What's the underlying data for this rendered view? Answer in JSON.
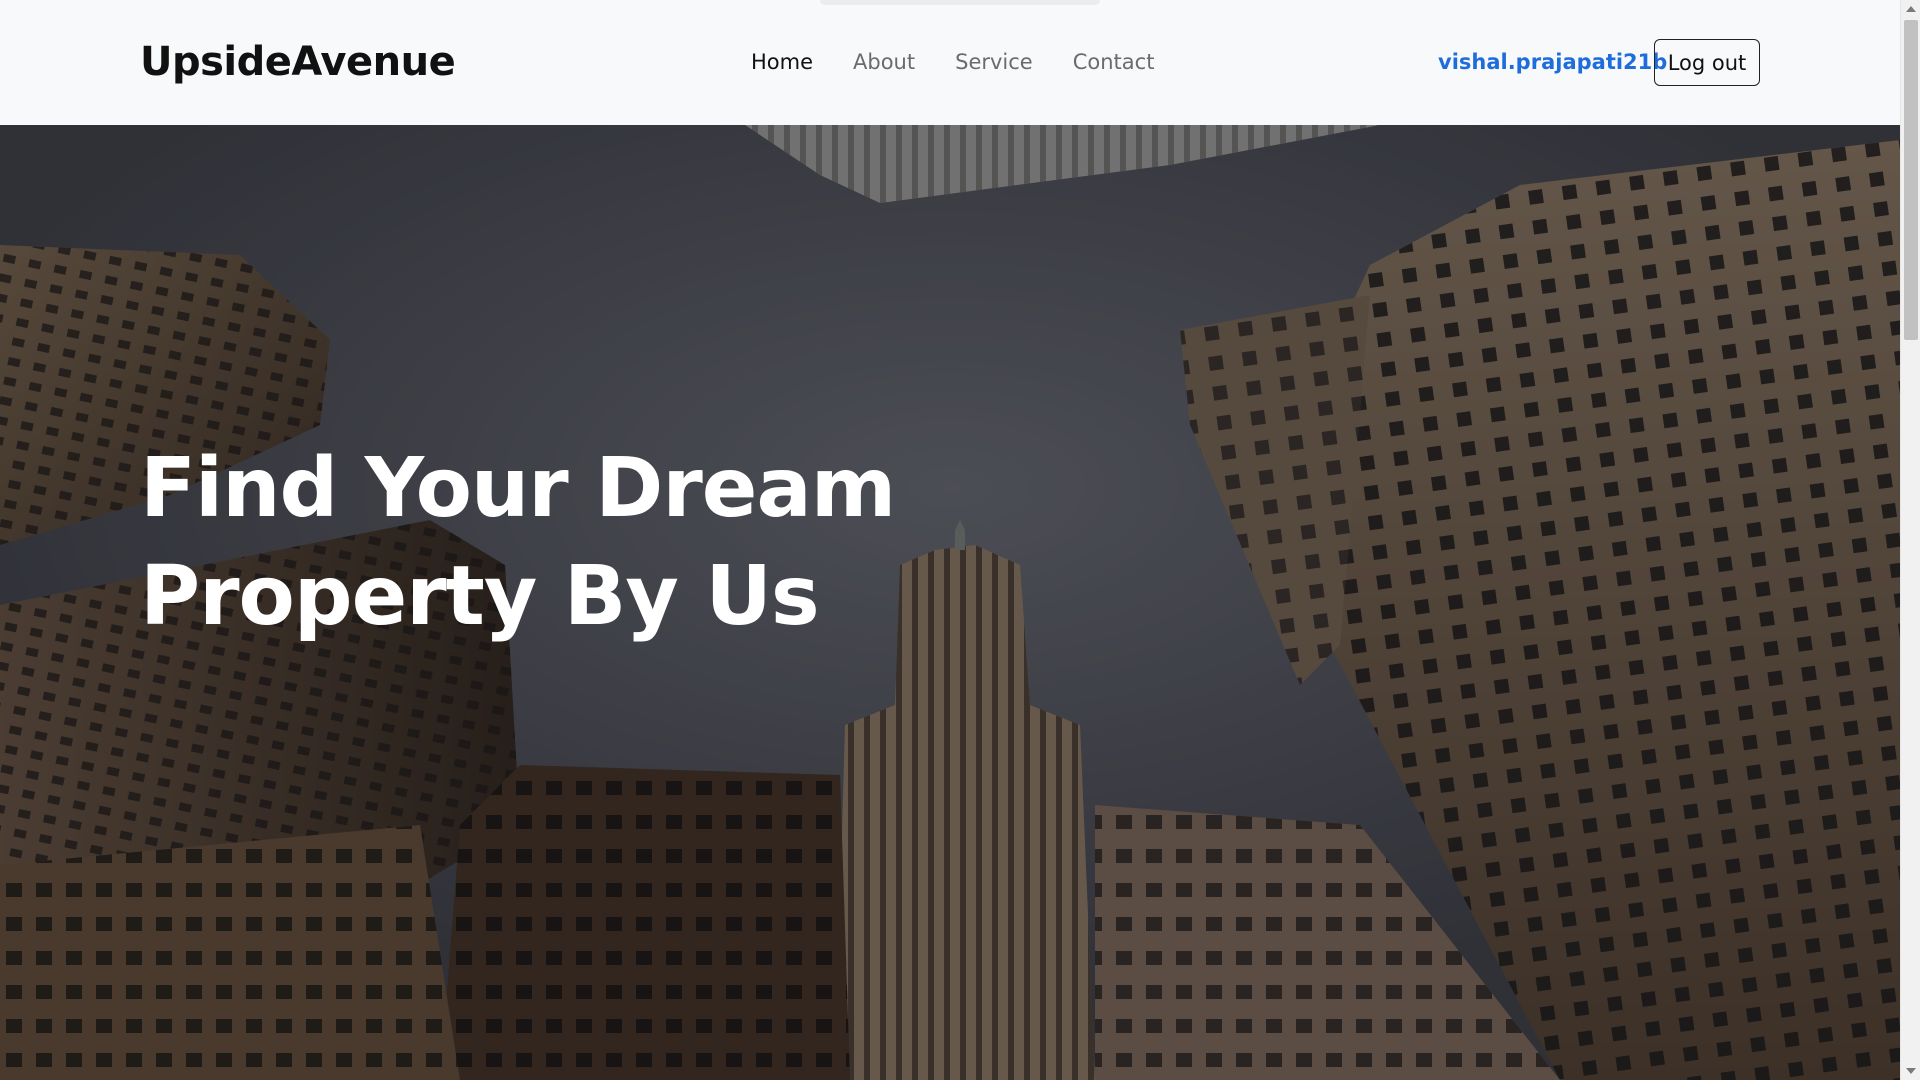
{
  "navbar": {
    "brand": "UpsideAvenue",
    "links": [
      "Home",
      "About",
      "Service",
      "Contact"
    ],
    "active_link": "Home",
    "username": "vishal.prajapati21b",
    "logout_label": "Log out"
  },
  "hero": {
    "title_line1": "Find Your Dream",
    "title_line2": "Property By Us",
    "background": "skyscrapers-looking-up-image"
  },
  "colors": {
    "accent": "#1f6ddd",
    "nav_background": "#f8f9fa",
    "hero_text": "#ffffff"
  }
}
